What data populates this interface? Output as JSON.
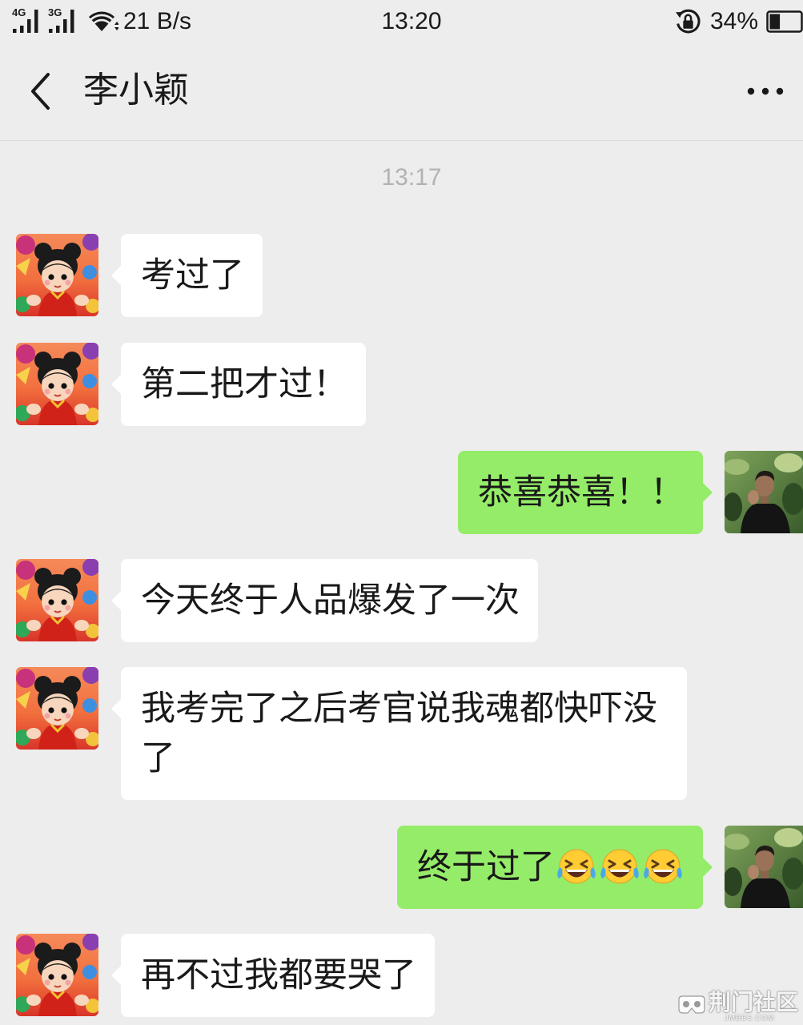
{
  "status_bar": {
    "network_primary": "4G",
    "network_secondary": "3G",
    "net_speed": "21 B/s",
    "time": "13:20",
    "battery": "34%"
  },
  "header": {
    "title": "李小颖"
  },
  "chat": {
    "timestamp": "13:17",
    "messages": [
      {
        "outgoing": false,
        "text": "考过了"
      },
      {
        "outgoing": false,
        "text": "第二把才过！"
      },
      {
        "outgoing": true,
        "text": "恭喜恭喜！！"
      },
      {
        "outgoing": false,
        "text": "今天终于人品爆发了一次"
      },
      {
        "outgoing": false,
        "text": "我考完了之后考官说我魂都快吓没了"
      },
      {
        "outgoing": true,
        "text": "终于过了",
        "emoji": [
          "face-with-tears-of-joy-icon",
          "face-with-tears-of-joy-icon",
          "face-with-tears-of-joy-icon"
        ]
      },
      {
        "outgoing": false,
        "text": "再不过我都要哭了"
      }
    ]
  },
  "watermark": {
    "name": "荆门社区",
    "site": "JMBBS.COM"
  },
  "icons": {
    "signal": "signal-bars-icon",
    "wifi": "wifi-icon",
    "rotation_lock": "rotation-lock-icon",
    "battery": "battery-icon",
    "back": "chevron-left-icon",
    "more": "more-dots-icon",
    "watermark_logo": "vr-goggles-logo-icon"
  },
  "colors": {
    "background": "#ededed",
    "incoming_bubble": "#ffffff",
    "outgoing_bubble": "#95ec69",
    "text": "#191919",
    "timestamp": "#b2b2b2"
  }
}
